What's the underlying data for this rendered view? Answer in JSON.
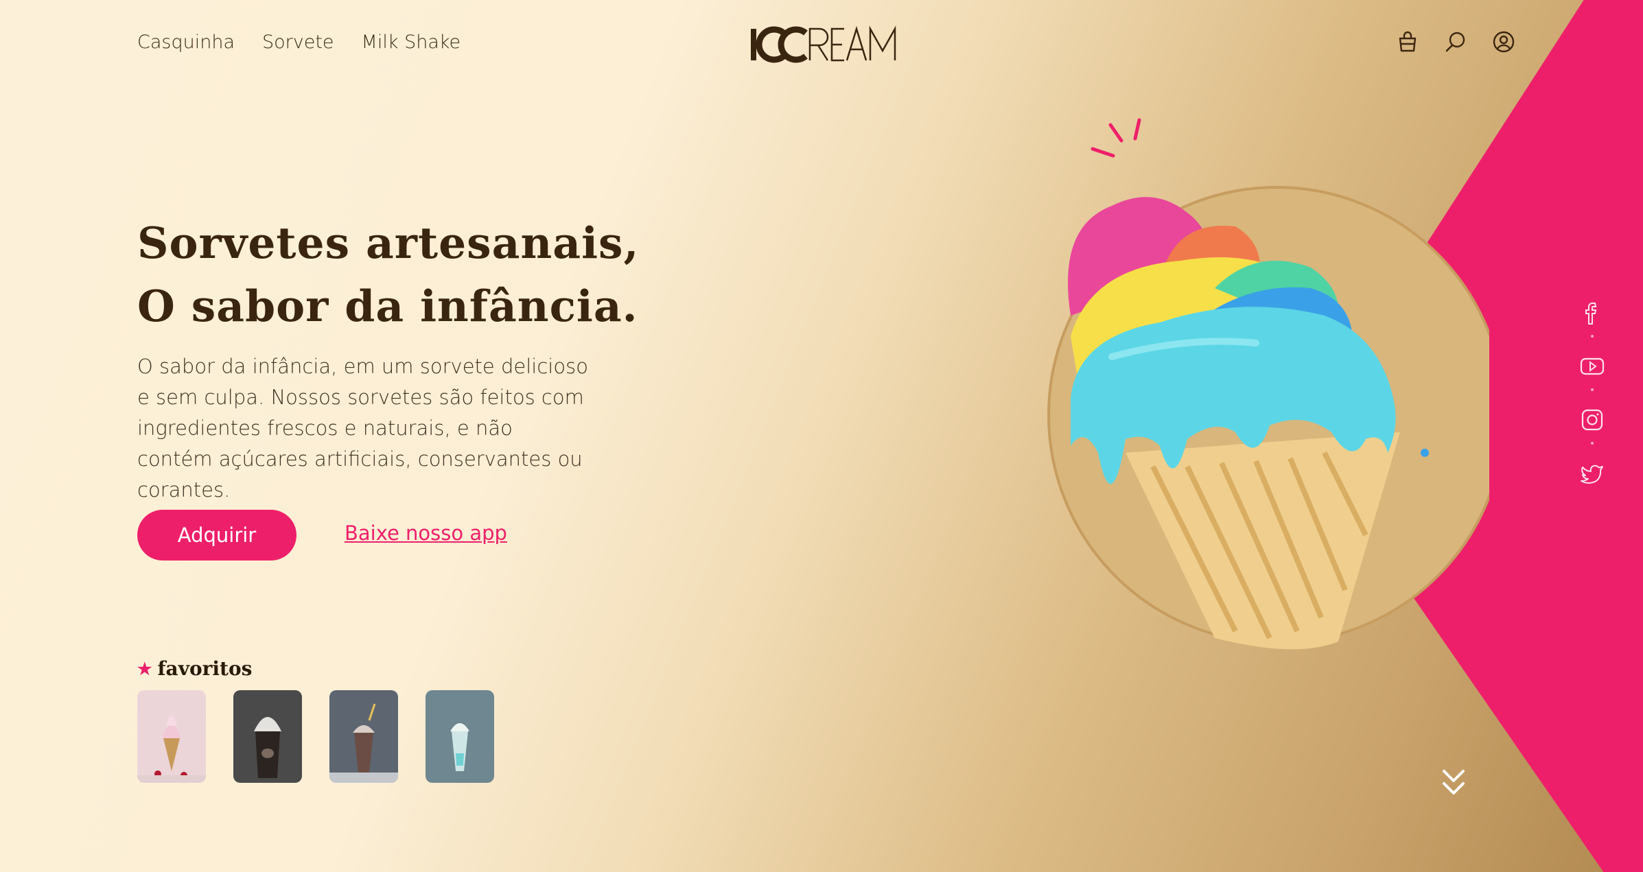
{
  "nav": {
    "items": [
      "Casquinha",
      "Sorvete",
      "Milk Shake"
    ]
  },
  "logo": {
    "text": "ICCREAM"
  },
  "header_icons": [
    "bag-icon",
    "search-icon",
    "user-icon"
  ],
  "hero": {
    "title_line1": "Sorvetes artesanais,",
    "title_line2": "O sabor da infância.",
    "description": "O sabor da infância, em um sorvete delicioso e sem culpa. Nossos sorvetes são feitos com ingredientes frescos e naturais, e não contém açúcares artificiais, conservantes ou corantes.",
    "buy_label": "Adquirir",
    "app_link_label": "Baixe nosso app"
  },
  "favorites": {
    "title": "favoritos",
    "star_icon": "star-icon",
    "items": [
      "ice-cream-cone-thumb",
      "milkshake-dark-thumb",
      "milkshake-chocolate-thumb",
      "milkshake-mint-thumb"
    ]
  },
  "social": [
    "facebook-icon",
    "youtube-icon",
    "instagram-icon",
    "twitter-icon"
  ],
  "colors": {
    "accent": "#ee1f6a",
    "text_dark": "#3a2510",
    "bg_light": "#fdf0d8",
    "bg_dark": "#b08850"
  }
}
